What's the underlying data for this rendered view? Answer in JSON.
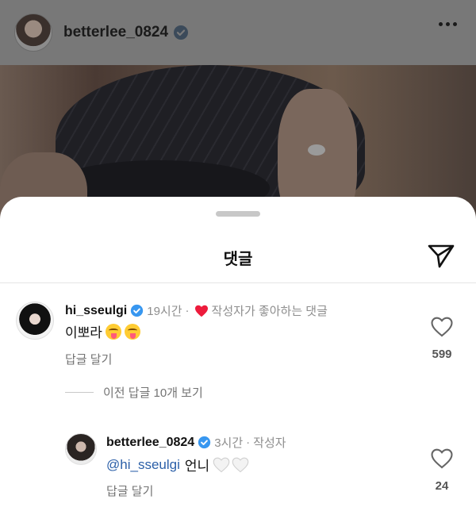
{
  "post": {
    "username": "betterlee_0824"
  },
  "sheet": {
    "title": "댓글"
  },
  "comments": [
    {
      "username": "hi_sseulgi",
      "time": "19시간",
      "separator": "·",
      "author_liked_label": "작성자가 좋아하는 댓글",
      "text": "이뽀라",
      "reply_label": "답글 달기",
      "likes": "599"
    }
  ],
  "view_replies": {
    "label": "이전 답글 10개 보기"
  },
  "replies": [
    {
      "username": "betterlee_0824",
      "time": "3시간",
      "separator": "·",
      "author_badge": "작성자",
      "mention": "@hi_sseulgi",
      "text": "언니",
      "reply_label": "답글 달기",
      "likes": "24"
    }
  ],
  "colors": {
    "verified": "#3897f0",
    "heart_red": "#ed1b3c",
    "mention": "#2b5fa8"
  },
  "icons": {
    "share": "paper-plane-icon",
    "like": "heart-outline-icon",
    "more": "more-dots-icon"
  }
}
